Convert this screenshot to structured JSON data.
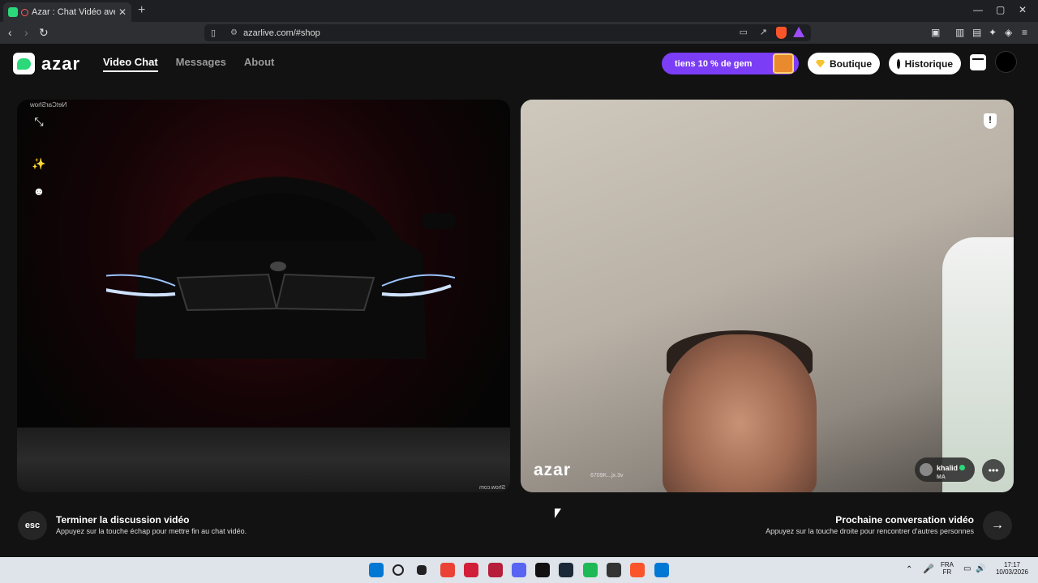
{
  "browser": {
    "tab_title": "Azar : Chat Vidéo avec de no",
    "tab_close": "✕",
    "new_tab": "+",
    "url": "azarlive.com/#shop",
    "back_icon": "‹",
    "forward_icon": "›",
    "reload_icon": "↻",
    "min_icon": "—",
    "max_icon": "▢",
    "close_icon": "✕"
  },
  "site": {
    "logo_text": "azar",
    "nav": [
      {
        "label": "Video Chat",
        "active": true
      },
      {
        "label": "Messages",
        "active": false
      },
      {
        "label": "About",
        "active": false
      }
    ],
    "promo_text": "tiens 10 % de gem",
    "boutique_label": "Boutique",
    "historique_label": "Historique"
  },
  "left_video": {
    "watermark_top": "NetCarShow",
    "watermark_bottom": "Show.com"
  },
  "right_video": {
    "brand_watermark": "azar",
    "session_id": "6709K...jx.3v",
    "user_name": "khalid",
    "user_country": "MA"
  },
  "controls": {
    "esc_label": "esc",
    "end_title": "Terminer la discussion vidéo",
    "end_subtitle": "Appuyez sur la touche échap pour mettre fin au chat vidéo.",
    "next_title": "Prochaine conversation vidéo",
    "next_subtitle": "Appuyez sur la touche droite pour rencontrer d'autres personnes",
    "next_icon": "→"
  },
  "taskbar": {
    "lang_top": "FRA",
    "lang_bottom": "FR",
    "time": "17:17",
    "date": "10/03/2026",
    "accent_colors": [
      "#0078d4",
      "#e8eef7",
      "#f0c23a",
      "#ea4335",
      "#d11f3a",
      "#b61e3a",
      "#5865f2",
      "#111111",
      "#1b2838",
      "#1db954",
      "#333333",
      "#fb542b"
    ]
  },
  "colors": {
    "brand_green": "#2bd97a",
    "promo_purple": "#7b3df5",
    "page_bg": "#121212"
  }
}
